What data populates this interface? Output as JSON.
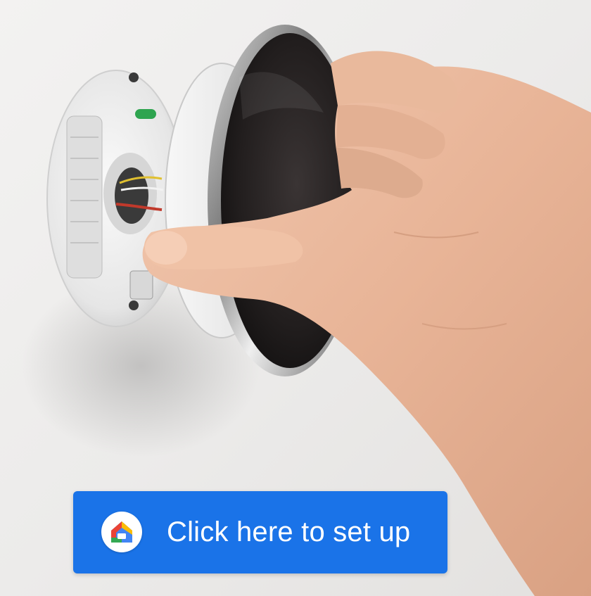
{
  "setup_button": {
    "label": "Click here to set up",
    "background": "#1a73e8",
    "icon": "google-home-icon"
  },
  "photo": {
    "subject": "thermostat-install-photo",
    "wall_color": "#eceae8",
    "display_color": "#2a2626"
  },
  "colors": {
    "google_red": "#ea4335",
    "google_yellow": "#fbbc04",
    "google_green": "#34a853",
    "google_blue": "#4285f4"
  }
}
